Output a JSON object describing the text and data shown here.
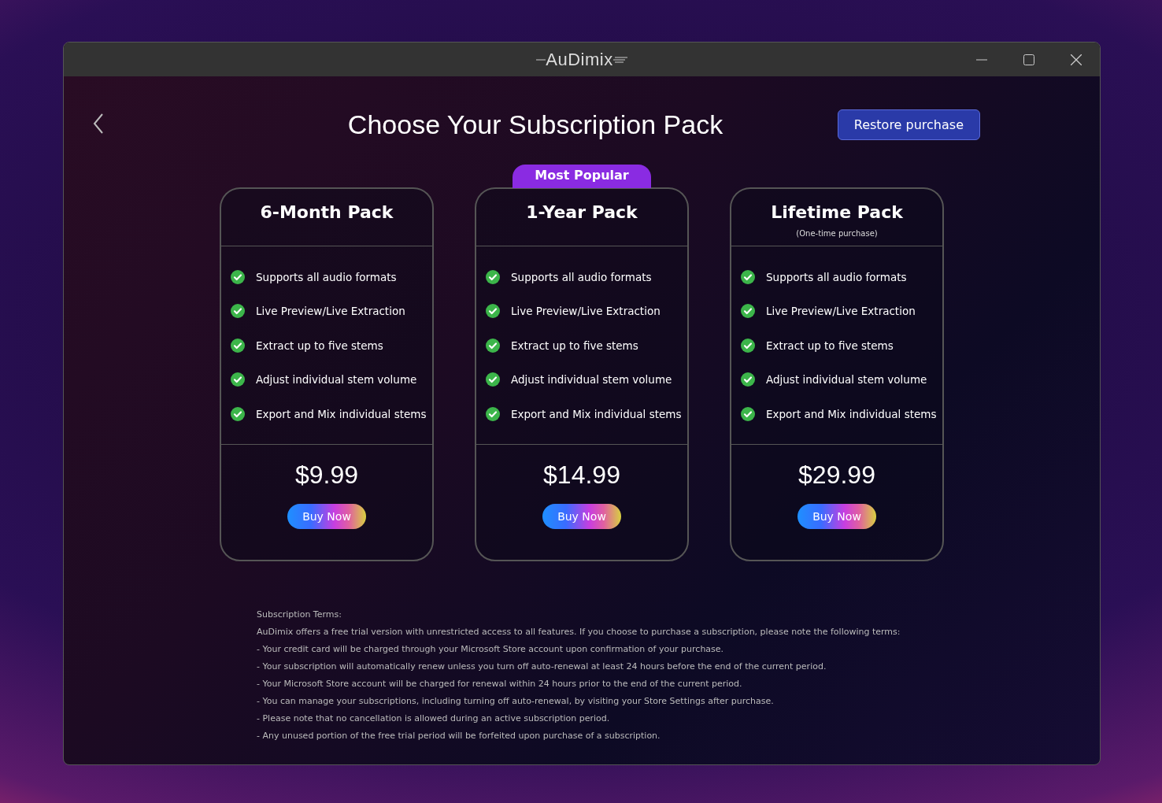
{
  "window": {
    "title": "AuDimix"
  },
  "header": {
    "title": "Choose Your Subscription Pack",
    "restore_button": "Restore purchase"
  },
  "plans": [
    {
      "name": "6-Month Pack",
      "features": [
        "Supports all audio formats",
        "Live Preview/Live Extraction",
        "Extract up to five stems",
        "Adjust individual stem volume",
        "Export and Mix individual stems"
      ],
      "price": "$9.99",
      "button": "Buy Now"
    },
    {
      "name": "1-Year Pack",
      "badge": "Most Popular",
      "features": [
        "Supports all audio formats",
        "Live Preview/Live Extraction",
        "Extract up to five stems",
        "Adjust individual stem volume",
        "Export and Mix individual stems"
      ],
      "price": "$14.99",
      "button": "Buy Now"
    },
    {
      "name": "Lifetime Pack",
      "subtitle": "(One-time purchase)",
      "features": [
        "Supports all audio formats",
        "Live Preview/Live Extraction",
        "Extract up to five stems",
        "Adjust individual stem volume",
        "Export and Mix individual stems"
      ],
      "price": "$29.99",
      "button": "Buy Now"
    }
  ],
  "terms": {
    "heading": "Subscription Terms:",
    "intro": "AuDimix offers a free trial version with unrestricted access to all features. If you choose to purchase a subscription, please note the following terms:",
    "items": [
      "- Your credit card will be charged through your Microsoft Store account upon confirmation of your purchase.",
      "- Your subscription will automatically renew unless you turn off auto-renewal at least 24 hours before the end of the current period.",
      "- Your Microsoft Store account will be charged for renewal within 24 hours prior to the end of the current period.",
      "- You can manage your subscriptions, including turning off auto-renewal, by visiting your Store Settings after purchase.",
      "- Please note that no cancellation is allowed during an active subscription period.",
      "- Any unused portion of the free trial period will be forfeited upon purchase of a subscription."
    ]
  }
}
